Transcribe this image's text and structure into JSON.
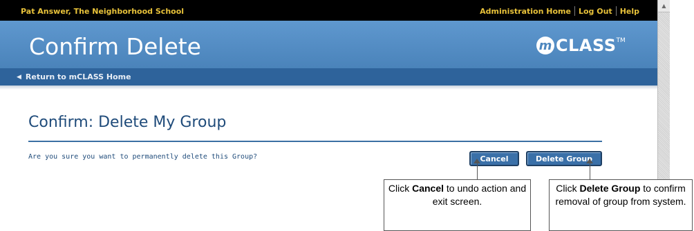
{
  "topbar": {
    "user": "Pat Answer, The Neighborhood School",
    "links": [
      "Administration Home",
      "Log Out",
      "Help"
    ]
  },
  "header": {
    "title": "Confirm Delete",
    "logo_mark": "m",
    "logo_text": "CLASS",
    "logo_tm": "TM"
  },
  "subnav": {
    "back_icon": "left-triangle-icon",
    "back_label": "Return to mCLASS Home"
  },
  "main": {
    "title": "Confirm: Delete My Group",
    "question": "Are you sure you want to permanently delete this Group?",
    "cancel_label": "Cancel",
    "delete_label": "Delete Group"
  },
  "callouts": {
    "cancel": {
      "pre": "Click ",
      "bold": "Cancel",
      "post": " to undo action and exit screen."
    },
    "delete": {
      "pre": "Click ",
      "bold": "Delete Group",
      "post": " to confirm removal of group from system."
    }
  },
  "colors": {
    "topbar_bg": "#000000",
    "topbar_text": "#e8c23a",
    "header_bg": "#4e87be",
    "subnav_bg": "#2e639b",
    "title_text": "#1f4b7a",
    "button_bg": "#3a70a8"
  }
}
